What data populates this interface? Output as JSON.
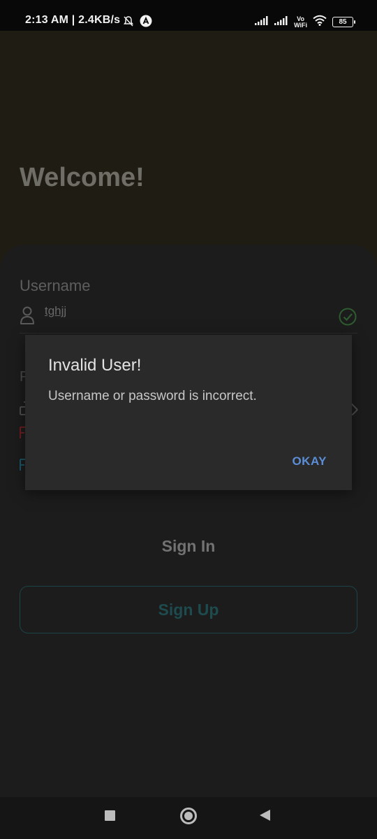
{
  "status_bar": {
    "time_speed": "2:13 AM | 2.4KB/s",
    "volte_top": "Vo",
    "volte_bottom": "WiFi",
    "battery": "85",
    "icons": [
      "mute-bell-icon",
      "app-a-icon",
      "signal-icon",
      "signal-icon",
      "wifi-icon",
      "battery-icon"
    ]
  },
  "header": {
    "title": "Welcome!"
  },
  "form": {
    "username_label": "Username",
    "username_value": "tghjj",
    "partial_password_label": "P",
    "sign_in": "Sign In",
    "sign_up": "Sign Up"
  },
  "dialog": {
    "title": "Invalid User!",
    "message": "Username or password is incorrect.",
    "button": "OKAY"
  },
  "colors": {
    "header_bg": "#1f1d13",
    "dialog_bg": "#2a2a2a",
    "accent_blue": "#5b8ed6",
    "check_green": "#2e7d32",
    "sign_up_teal": "#1b4549"
  }
}
